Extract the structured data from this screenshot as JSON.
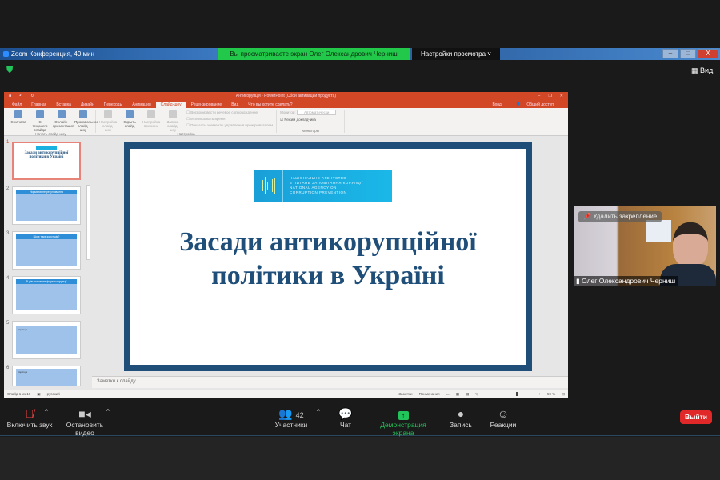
{
  "zoom": {
    "window_title": "Zoom Конференция, 40 мин",
    "viewing_banner": "Вы просматриваете экран Олег Олександрович Черниш",
    "view_settings": "Настройки просмотра ˅",
    "view_button": "Вид",
    "window_controls": [
      "–",
      "□",
      "X"
    ]
  },
  "ppt": {
    "title": "Антикорупція - PowerPoint (Сбой активации продукта)",
    "tabs": [
      "Файл",
      "Главная",
      "Вставка",
      "Дизайн",
      "Переходы",
      "Анимация",
      "Слайд-шоу",
      "Рецензирование",
      "Вид",
      "Что вы хотите сделать?"
    ],
    "active_tab": "Слайд-шоу",
    "signin": "Вход",
    "share": "Общий доступ",
    "ribbon": {
      "groups": [
        {
          "name": "Начать слайд-шоу",
          "buttons": [
            "С начала",
            "С текущего слайда",
            "Онлайн-презентация",
            "Произвольное слайд-шоу"
          ]
        },
        {
          "name": "Настройка",
          "buttons": [
            "Настройка слайд-шоу",
            "Скрыть слайд",
            "Настройка времени",
            "Запись слайд-шоу"
          ],
          "checks": [
            "Воспроизвести речевое сопровождение",
            "Использовать время",
            "Показать элементы управления проигрывателем"
          ]
        },
        {
          "name": "Мониторы",
          "monitor_label": "Монитор:",
          "monitor_value": "Автоматически",
          "presenter_mode": "Режим докладчика"
        }
      ]
    },
    "thumbnails": [
      {
        "num": "1",
        "title": "Засади антикорупційної політики в Україні"
      },
      {
        "num": "2",
        "title": "Нормативне регулювання"
      },
      {
        "num": "3",
        "title": "Що є таке корупція?"
      },
      {
        "num": "4",
        "title": "В дію основних форми корупції"
      },
      {
        "num": "5",
        "title": "Корупція"
      },
      {
        "num": "6",
        "title": "Корупція"
      }
    ],
    "slide": {
      "logo_lines": [
        "НАЦІОНАЛЬНЕ АГЕНТСТВО",
        "З ПИТАНЬ ЗАПОБІГАННЯ КОРУПЦІЇ",
        "NATIONAL AGENCY ON",
        "CORRUPTION PREVENTION"
      ],
      "title_line1": "Засади антикорупційної",
      "title_line2": "політики в Україні"
    },
    "notes_placeholder": "Заметки к слайду",
    "status": {
      "slide_info": "Слайд 1 из 19",
      "language": "русский",
      "notes": "Заметки",
      "comments": "Примечания",
      "zoom": "59 %"
    }
  },
  "video": {
    "unpin": "Удалить закрепление",
    "name": "Олег Олександрович Черниш"
  },
  "toolbar": {
    "unmute": "Включить звук",
    "stop_video": "Остановить видео",
    "participants": "Участники",
    "participants_count": "42",
    "chat": "Чат",
    "share_screen": "Демонстрация экрана",
    "record": "Запись",
    "reactions": "Реакции",
    "leave": "Выйти"
  },
  "colors": {
    "ppt_accent": "#d24726",
    "share_green": "#21c84a",
    "leave_red": "#e02828",
    "slide_border": "#1f4e79"
  }
}
